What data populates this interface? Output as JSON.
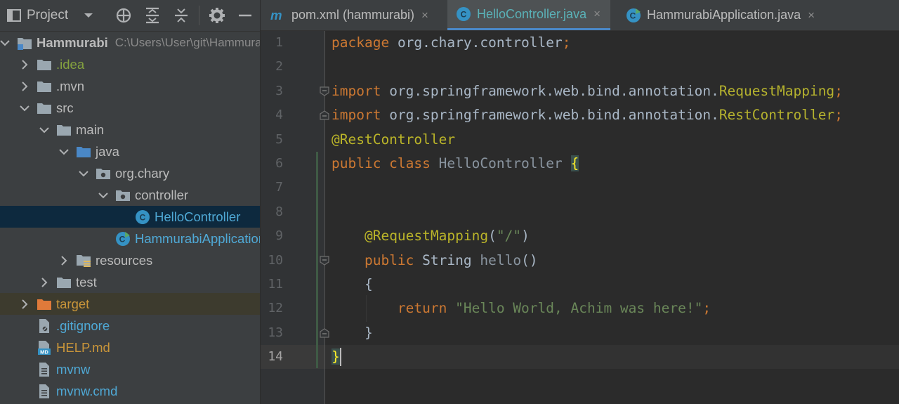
{
  "project_panel": {
    "title": "Project",
    "toolbar_icons": [
      "globe-target-icon",
      "expand-all-icon",
      "collapse-all-icon",
      "gear-icon",
      "minimize-icon"
    ],
    "tree": [
      {
        "label": "Hammurabi",
        "path": "C:\\Users\\User\\git\\Hammurabi",
        "icon": "module-folder-icon",
        "expanded": true,
        "bold": true
      },
      {
        "label": ".idea",
        "icon": "folder-icon",
        "expanded": false,
        "color": "#85a33f"
      },
      {
        "label": ".mvn",
        "icon": "folder-icon",
        "expanded": false
      },
      {
        "label": "src",
        "icon": "folder-icon",
        "expanded": true
      },
      {
        "label": "main",
        "icon": "folder-icon",
        "expanded": true
      },
      {
        "label": "java",
        "icon": "source-folder-icon",
        "expanded": true
      },
      {
        "label": "org.chary",
        "icon": "package-icon",
        "expanded": true
      },
      {
        "label": "controller",
        "icon": "package-icon",
        "expanded": true
      },
      {
        "label": "HelloController",
        "icon": "java-class-icon",
        "selected": true,
        "color": "#4fa9d6"
      },
      {
        "label": "HammurabiApplication",
        "icon": "spring-class-icon",
        "color": "#4fa9d6"
      },
      {
        "label": "resources",
        "icon": "resources-folder-icon",
        "expanded": false
      },
      {
        "label": "test",
        "icon": "folder-icon",
        "expanded": false
      },
      {
        "label": "target",
        "icon": "excluded-folder-icon",
        "expanded": false,
        "color": "#c9953a"
      },
      {
        "label": ".gitignore",
        "icon": "gitignore-file-icon",
        "color": "#4fa9d6"
      },
      {
        "label": "HELP.md",
        "icon": "markdown-file-icon",
        "color": "#c9953a"
      },
      {
        "label": "mvnw",
        "icon": "text-file-icon",
        "color": "#4fa9d6"
      },
      {
        "label": "mvnw.cmd",
        "icon": "text-file-icon",
        "color": "#4fa9d6"
      }
    ]
  },
  "tabs": [
    {
      "label": "pom.xml (hammurabi)",
      "icon": "maven-icon",
      "active": false,
      "close": "×"
    },
    {
      "label": "HelloController.java",
      "icon": "java-class-icon",
      "active": true,
      "close": "×"
    },
    {
      "label": "HammurabiApplication.java",
      "icon": "spring-class-icon",
      "active": false,
      "close": "×"
    }
  ],
  "editor": {
    "current_line": 14,
    "line_numbers": [
      "1",
      "2",
      "3",
      "4",
      "5",
      "6",
      "7",
      "8",
      "9",
      "10",
      "11",
      "12",
      "13",
      "14"
    ],
    "lines": [
      "package org.chary.controller;",
      "",
      "import org.springframework.web.bind.annotation.RequestMapping;",
      "import org.springframework.web.bind.annotation.RestController;",
      "@RestController",
      "public class HelloController {",
      "",
      "",
      "    @RequestMapping(\"/\")",
      "    public String hello()",
      "    {",
      "        return \"Hello World, Achim was here!\";",
      "    }",
      "}"
    ]
  },
  "colors": {
    "keyword": "#cc7832",
    "annotation": "#bbb529",
    "string": "#6a8759",
    "text": "#a9b7c6",
    "accent": "#4a88c7"
  }
}
